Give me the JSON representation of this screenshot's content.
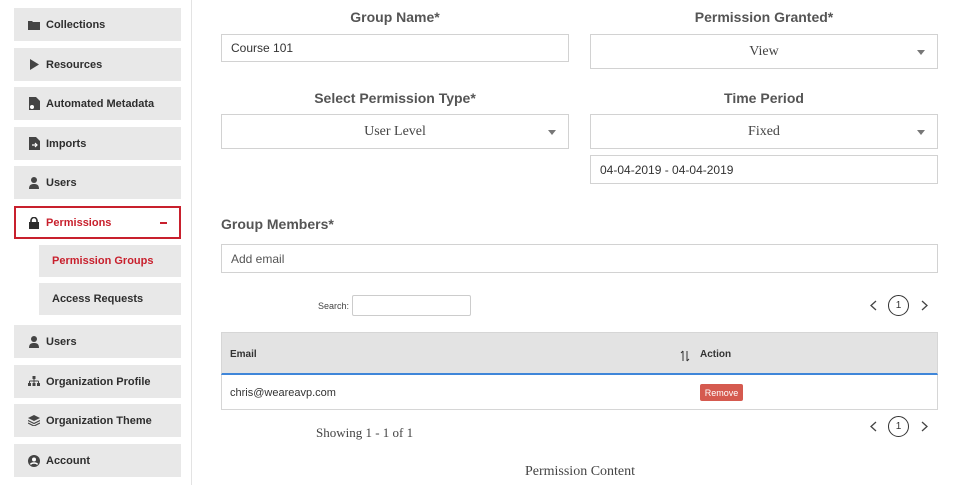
{
  "sidebar": {
    "items": [
      {
        "label": "Collections",
        "icon": "folder-icon"
      },
      {
        "label": "Resources",
        "icon": "play-icon"
      },
      {
        "label": "Automated Metadata",
        "icon": "metadata-icon"
      },
      {
        "label": "Imports",
        "icon": "file-import-icon"
      },
      {
        "label": "Users",
        "icon": "user-icon"
      },
      {
        "label": "Permissions",
        "icon": "lock-icon",
        "expanded": true
      },
      {
        "label": "Users",
        "icon": "user-icon"
      },
      {
        "label": "Organization Profile",
        "icon": "org-chart-icon"
      },
      {
        "label": "Organization Theme",
        "icon": "layers-icon"
      },
      {
        "label": "Account",
        "icon": "account-circle-icon"
      }
    ],
    "submenu": [
      {
        "label": "Permission Groups",
        "active": true
      },
      {
        "label": "Access Requests",
        "active": false
      }
    ]
  },
  "form": {
    "group_name_label": "Group Name*",
    "group_name_value": "Course 101",
    "permission_granted_label": "Permission Granted*",
    "permission_granted_value": "View",
    "permission_type_label": "Select Permission Type*",
    "permission_type_value": "User Level",
    "time_period_label": "Time Period",
    "time_period_value": "Fixed",
    "date_range_value": "04-04-2019 - 04-04-2019",
    "group_members_label": "Group Members*",
    "add_email_placeholder": "Add email"
  },
  "table": {
    "search_label": "Search:",
    "search_value": "",
    "current_page": "1",
    "columns": {
      "email": "Email",
      "action": "Action"
    },
    "rows": [
      {
        "email": "chris@weareavp.com",
        "action": "Remove"
      }
    ],
    "showing_text": "Showing 1 - 1 of 1",
    "bottom_page": "1"
  },
  "footer_heading": "Permission Content",
  "colors": {
    "accent_red": "#c8202d",
    "remove_button": "#d55a4f",
    "table_header_border": "#3f86d9",
    "nav_bg": "#e8e8e8"
  }
}
